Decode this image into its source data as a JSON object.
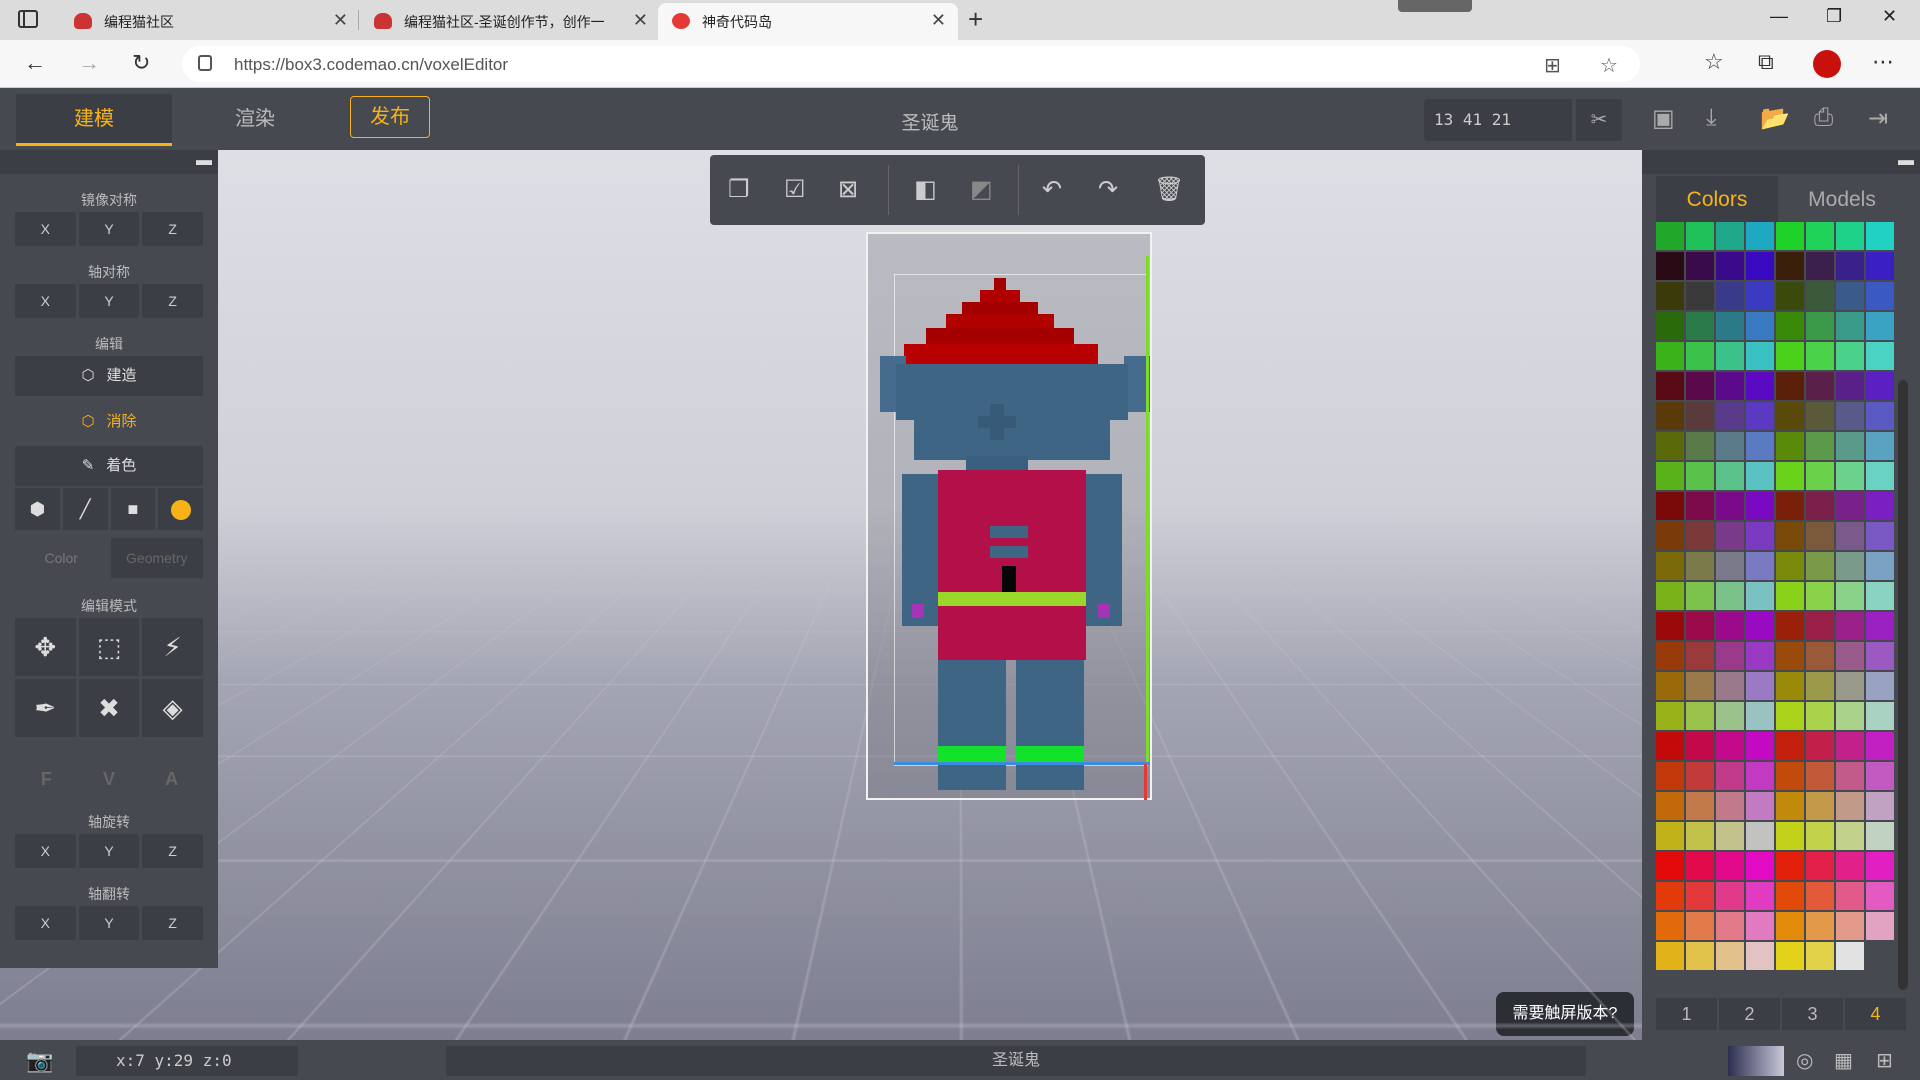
{
  "browser": {
    "tabs": [
      {
        "title": "编程猫社区",
        "icon": "codemao-cat-icon",
        "active": false
      },
      {
        "title": "编程猫社区-圣诞创作节，创作一",
        "icon": "codemao-cat-icon",
        "active": false
      },
      {
        "title": "神奇代码岛",
        "icon": "box3-star-icon",
        "active": true
      }
    ],
    "url": "https://box3.codemao.cn/voxelEditor"
  },
  "header": {
    "tabs": {
      "model": "建模",
      "render": "渲染"
    },
    "publish": "发布",
    "project_title": "圣诞鬼",
    "size": "13  41  21"
  },
  "left_panel": {
    "mirror_label": "镜像对称",
    "axis_sym_label": "轴对称",
    "edit_label": "编辑",
    "build": "建造",
    "erase": "消除",
    "paint": "着色",
    "color_tab": "Color",
    "geometry_tab": "Geometry",
    "edit_mode_label": "编辑模式",
    "fva": [
      "F",
      "V",
      "A"
    ],
    "rotate_label": "轴旋转",
    "flip_label": "轴翻转",
    "axes": [
      "X",
      "Y",
      "Z"
    ],
    "accent": "#f7b218"
  },
  "right_panel": {
    "colors_tab": "Colors",
    "models_tab": "Models",
    "pages": [
      "1",
      "2",
      "3",
      "4"
    ],
    "active_page": "4",
    "palette": [
      "#1fa82a",
      "#1fc25a",
      "#1fa88a",
      "#1fa8c2",
      "#1fd22a",
      "#1fd25a",
      "#1fd28a",
      "#1fd2c2",
      "#2a0a14",
      "#3a0a4a",
      "#3a0a8a",
      "#3a0ac2",
      "#3a200a",
      "#3a204a",
      "#3a208a",
      "#3a20c2",
      "#3a3a0a",
      "#3a3a3a",
      "#3a3a8a",
      "#3a3ac2",
      "#3a4a0a",
      "#3a5a3a",
      "#3a5a8a",
      "#3a5ac2",
      "#2a6a0a",
      "#2a7a4a",
      "#2a7a8a",
      "#3a7ac2",
      "#3a8a0a",
      "#3a9a4a",
      "#3a9a8a",
      "#3aa2c2",
      "#3ab21a",
      "#3ac24a",
      "#3ac28a",
      "#3ac2c2",
      "#4ad21a",
      "#4ad24a",
      "#4ad28a",
      "#4ad2c2",
      "#5a0a14",
      "#5a0a4a",
      "#5a0a8a",
      "#5a0ac2",
      "#5a200a",
      "#5a204a",
      "#5a208a",
      "#5a20c2",
      "#5a3a0a",
      "#5a3a3a",
      "#5a3a8a",
      "#5a3ac2",
      "#5a4a0a",
      "#5a5a3a",
      "#5a5a8a",
      "#5a5ac2",
      "#5a6a0a",
      "#5a7a4a",
      "#5a7a8a",
      "#5a7ac2",
      "#5a8a0a",
      "#5a9a4a",
      "#5a9a8a",
      "#5aa2c2",
      "#5ab21a",
      "#5ac24a",
      "#5ac28a",
      "#5ac2c2",
      "#6ad21a",
      "#6ad24a",
      "#6ad28a",
      "#6ad2c2",
      "#7a0a0a",
      "#7a0a4a",
      "#7a0a8a",
      "#7a0ac2",
      "#7a200a",
      "#7a204a",
      "#7a208a",
      "#7a20c2",
      "#7a3a0a",
      "#7a3a3a",
      "#7a3a8a",
      "#7a3ac2",
      "#7a4a0a",
      "#7a5a3a",
      "#7a5a8a",
      "#7a5ac2",
      "#7a6a0a",
      "#7a7a4a",
      "#7a7a8a",
      "#7a7ac2",
      "#7a8a0a",
      "#7a9a4a",
      "#7a9a8a",
      "#7aa2c2",
      "#7ab21a",
      "#7ac24a",
      "#7ac28a",
      "#7ac2c2",
      "#8ad21a",
      "#8ad24a",
      "#8ad28a",
      "#8ad2c2",
      "#9a0a0a",
      "#9a0a4a",
      "#9a0a8a",
      "#9a0ac2",
      "#9a200a",
      "#9a204a",
      "#9a208a",
      "#9a20c2",
      "#9a3a0a",
      "#9a3a3a",
      "#9a3a8a",
      "#9a3ac2",
      "#9a4a0a",
      "#9a5a3a",
      "#9a5a8a",
      "#9a5ac2",
      "#9a6a0a",
      "#9a7a4a",
      "#9a7a8a",
      "#9a7ac2",
      "#9a8a0a",
      "#9a9a4a",
      "#9a9a8a",
      "#9aa2c2",
      "#9ab21a",
      "#9ac24a",
      "#9ac28a",
      "#9ac2c2",
      "#aad21a",
      "#aad24a",
      "#aad28a",
      "#aad2c2",
      "#c20a0a",
      "#c20a4a",
      "#c20a8a",
      "#c20ac2",
      "#c2200a",
      "#c2204a",
      "#c2208a",
      "#c220c2",
      "#c23a0a",
      "#c23a3a",
      "#c23a8a",
      "#c23ac2",
      "#c24a0a",
      "#c25a3a",
      "#c25a8a",
      "#c25ac2",
      "#c26a0a",
      "#c27a4a",
      "#c27a8a",
      "#c27ac2",
      "#c28a0a",
      "#c29a4a",
      "#c29a8a",
      "#c2a2c2",
      "#c2b21a",
      "#c2c24a",
      "#c2c28a",
      "#c2c2c2",
      "#c2d21a",
      "#c2d24a",
      "#c2d28a",
      "#c2d2c2",
      "#e20a0a",
      "#e20a4a",
      "#e20a8a",
      "#e20ac2",
      "#e2200a",
      "#e2204a",
      "#e2208a",
      "#e220c2",
      "#e23a0a",
      "#e23a3a",
      "#e23a8a",
      "#e23ac2",
      "#e24a0a",
      "#e25a3a",
      "#e25a8a",
      "#e25ac2",
      "#e26a0a",
      "#e27a4a",
      "#e27a8a",
      "#e27ac2",
      "#e28a0a",
      "#e29a4a",
      "#e29a8a",
      "#e2a2c2",
      "#e2b21a",
      "#e2c24a",
      "#e2c28a",
      "#e2c2c2",
      "#e2d21a",
      "#e2d24a",
      "#e2e2e2",
      "#464a50"
    ]
  },
  "touch_tip": "需要触屏版本?",
  "status": {
    "coords": "x:7 y:29 z:0",
    "name": "圣诞鬼"
  }
}
